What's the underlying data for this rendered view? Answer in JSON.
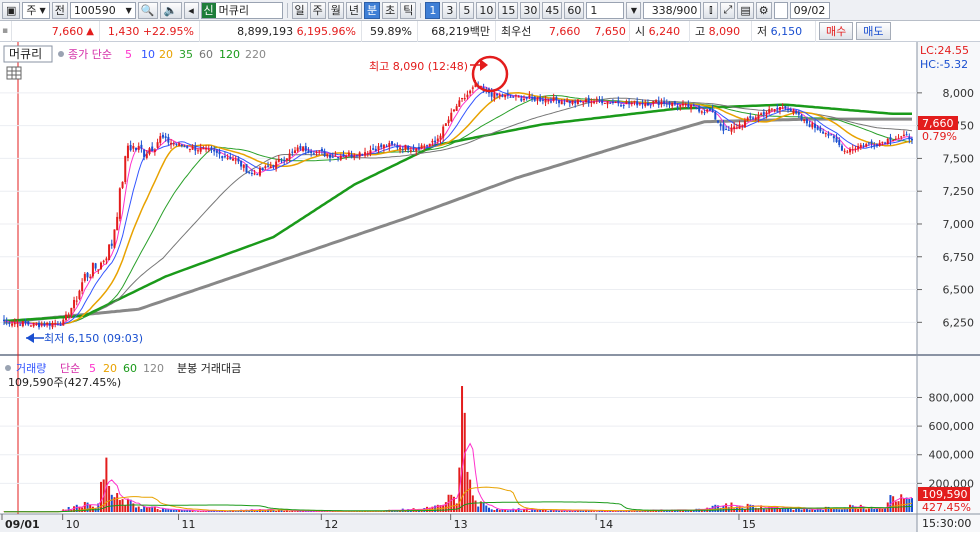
{
  "toolbar": {
    "mode": "주",
    "prefix": "전",
    "code": "100590",
    "tag": "신",
    "name": "머큐리",
    "period_tabs": [
      "일",
      "주",
      "월",
      "년",
      "분",
      "초",
      "틱"
    ],
    "selected_period": "분",
    "intervals": [
      "1",
      "3",
      "5",
      "10",
      "15",
      "30",
      "45",
      "60"
    ],
    "selected_interval": "1",
    "custom_interval": "1",
    "count": "338",
    "count_total": "/900",
    "date": "09/02"
  },
  "info": {
    "price": "7,660",
    "change": "1,430",
    "change_pct": "+22.95%",
    "volume": "8,899,193",
    "volume_pct": "6,195.96%",
    "ratio": "59.89%",
    "amount": "68,219백만",
    "best_label": "최우선",
    "best_ask": "7,660",
    "best_bid": "7,650",
    "open_label": "시",
    "open": "6,240",
    "high_label": "고",
    "high": "8,090",
    "low_label": "저",
    "low": "6,150",
    "buy_label": "매수",
    "sell_label": "매도"
  },
  "legend": {
    "stock": "머큐리",
    "ma_label": "종가 단순",
    "ma_periods": [
      "5",
      "10",
      "20",
      "35",
      "60",
      "120",
      "220"
    ],
    "vol_label": "거래량",
    "vol_ma_label": "단순",
    "vol_ma_periods": [
      "5",
      "20",
      "60",
      "120"
    ],
    "vol_extra": "분봉 거래대금",
    "vol_value": "109,590주(427.45%)"
  },
  "annotations": {
    "high": "최고 8,090 (12:48)",
    "low": "최저 6,150 (09:03)",
    "lc": "LC:24.55",
    "hc": "HC:-5.32",
    "price_tag": "7,660",
    "pct_tag": "0.79%",
    "vol_tag": "109,590",
    "vol_pct_tag": "427.45%",
    "time_label": "15:30:00"
  },
  "colors": {
    "up": "#e31c1c",
    "down": "#1a4fd0",
    "ma5": "#ff33cc",
    "ma10": "#3355ff",
    "ma20": "#e8a200",
    "ma35": "#2aa02a",
    "ma60": "#777777",
    "ma120": "#1a9a1a",
    "ma220": "#888888"
  },
  "chart_data": {
    "type": "candlestick",
    "price_axis": {
      "min": 6150,
      "max": 8200,
      "ticks": [
        6250,
        6500,
        6750,
        7000,
        7250,
        7500,
        7750,
        8000
      ]
    },
    "volume_axis": {
      "ticks": [
        200000,
        400000,
        600000,
        800000
      ]
    },
    "x_labels": [
      "09/01",
      "10",
      "11",
      "12",
      "13",
      "14",
      "15"
    ],
    "close_path": [
      [
        0,
        6260
      ],
      [
        12,
        6230
      ],
      [
        22,
        6250
      ],
      [
        26,
        6400
      ],
      [
        30,
        6600
      ],
      [
        36,
        6700
      ],
      [
        40,
        6850
      ],
      [
        46,
        7600
      ],
      [
        52,
        7550
      ],
      [
        58,
        7650
      ],
      [
        65,
        7600
      ],
      [
        75,
        7560
      ],
      [
        85,
        7500
      ],
      [
        92,
        7380
      ],
      [
        100,
        7450
      ],
      [
        110,
        7580
      ],
      [
        122,
        7520
      ],
      [
        132,
        7540
      ],
      [
        142,
        7600
      ],
      [
        152,
        7580
      ],
      [
        160,
        7620
      ],
      [
        168,
        7900
      ],
      [
        175,
        8050
      ],
      [
        182,
        7980
      ],
      [
        192,
        7960
      ],
      [
        202,
        7950
      ],
      [
        212,
        7930
      ],
      [
        222,
        7940
      ],
      [
        232,
        7920
      ],
      [
        244,
        7930
      ],
      [
        252,
        7900
      ],
      [
        262,
        7860
      ],
      [
        268,
        7700
      ],
      [
        275,
        7780
      ],
      [
        282,
        7850
      ],
      [
        290,
        7900
      ],
      [
        297,
        7780
      ],
      [
        305,
        7700
      ],
      [
        312,
        7560
      ],
      [
        318,
        7600
      ],
      [
        325,
        7620
      ],
      [
        330,
        7660
      ]
    ],
    "ma120": [
      [
        0,
        6260
      ],
      [
        30,
        6300
      ],
      [
        60,
        6600
      ],
      [
        100,
        6900
      ],
      [
        130,
        7300
      ],
      [
        160,
        7600
      ],
      [
        200,
        7760
      ],
      [
        250,
        7880
      ],
      [
        290,
        7910
      ],
      [
        330,
        7840
      ]
    ],
    "ma220": [
      [
        0,
        6250
      ],
      [
        50,
        6350
      ],
      [
        100,
        6700
      ],
      [
        150,
        7050
      ],
      [
        190,
        7350
      ],
      [
        230,
        7600
      ],
      [
        260,
        7780
      ],
      [
        300,
        7800
      ],
      [
        330,
        7800
      ]
    ],
    "volume_bars": [
      [
        0,
        2000
      ],
      [
        5,
        3000
      ],
      [
        10,
        2000
      ],
      [
        20,
        5000
      ],
      [
        26,
        40000
      ],
      [
        30,
        70000
      ],
      [
        32,
        50000
      ],
      [
        35,
        60000
      ],
      [
        38,
        380000
      ],
      [
        40,
        120000
      ],
      [
        44,
        90000
      ],
      [
        48,
        60000
      ],
      [
        52,
        40000
      ],
      [
        60,
        20000
      ],
      [
        70,
        10000
      ],
      [
        80,
        8000
      ],
      [
        95,
        20000
      ],
      [
        110,
        8000
      ],
      [
        125,
        5000
      ],
      [
        140,
        10000
      ],
      [
        150,
        20000
      ],
      [
        158,
        30000
      ],
      [
        163,
        50000
      ],
      [
        166,
        120000
      ],
      [
        168,
        60000
      ],
      [
        170,
        880000
      ],
      [
        172,
        280000
      ],
      [
        175,
        80000
      ],
      [
        180,
        30000
      ],
      [
        200,
        15000
      ],
      [
        230,
        10000
      ],
      [
        260,
        20000
      ],
      [
        268,
        60000
      ],
      [
        285,
        40000
      ],
      [
        300,
        20000
      ],
      [
        318,
        50000
      ],
      [
        325,
        30000
      ],
      [
        330,
        110000
      ]
    ]
  }
}
